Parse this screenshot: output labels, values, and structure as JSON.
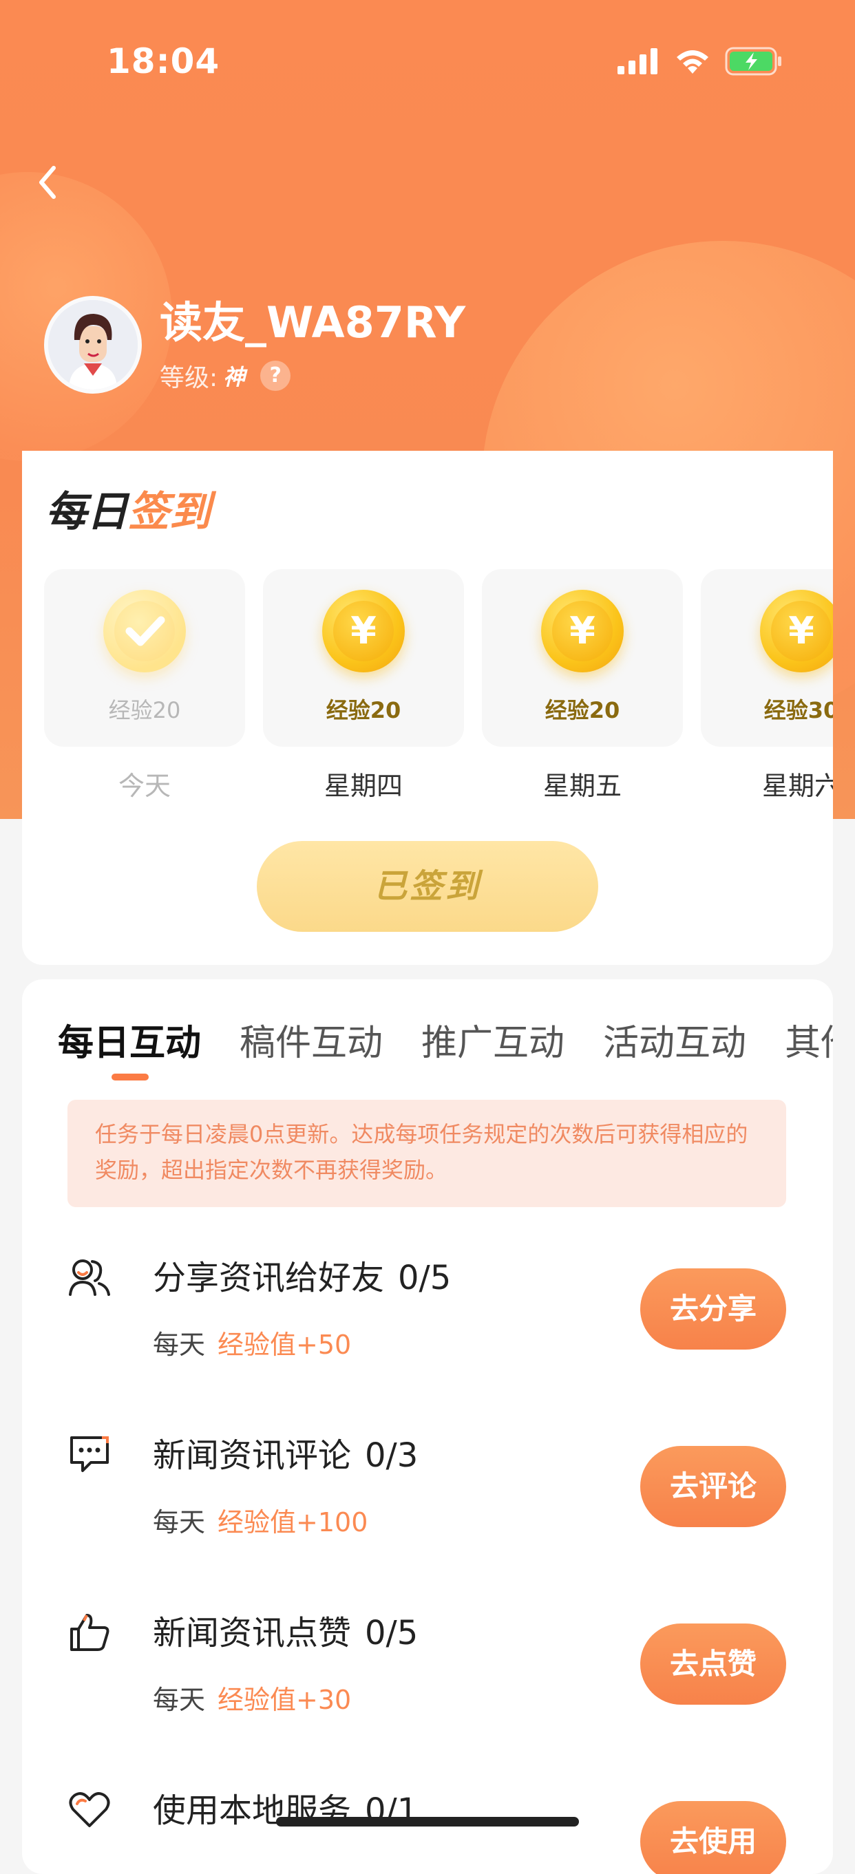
{
  "status_bar": {
    "time": "18:04"
  },
  "profile": {
    "username": "读友_WA87RY",
    "level_label": "等级:",
    "level_value": "神",
    "help": "?"
  },
  "signin": {
    "title_part1": "每日",
    "title_part2": "签到",
    "days": [
      {
        "exp": "经验20",
        "label": "今天",
        "done": true
      },
      {
        "exp": "经验20",
        "label": "星期四",
        "done": false
      },
      {
        "exp": "经验20",
        "label": "星期五",
        "done": false
      },
      {
        "exp": "经验30",
        "label": "星期六",
        "done": false
      }
    ],
    "button": "已签到"
  },
  "tasks_section": {
    "tabs": [
      "每日互动",
      "稿件互动",
      "推广互动",
      "活动互动",
      "其他"
    ],
    "active_tab": 0,
    "notice": "任务于每日凌晨0点更新。达成每项任务规定的次数后可获得相应的奖励，超出指定次数不再获得奖励。",
    "tasks": [
      {
        "icon": "share-friends-icon",
        "title": "分享资讯给好友",
        "count": "0/5",
        "period": "每天",
        "reward": "经验值+50",
        "button": "去分享"
      },
      {
        "icon": "comment-icon",
        "title": "新闻资讯评论",
        "count": "0/3",
        "period": "每天",
        "reward": "经验值+100",
        "button": "去评论"
      },
      {
        "icon": "thumbs-up-icon",
        "title": "新闻资讯点赞",
        "count": "0/5",
        "period": "每天",
        "reward": "经验值+30",
        "button": "去点赞"
      },
      {
        "icon": "heart-icon",
        "title": "使用本地服务",
        "count": "0/1",
        "period": "每天",
        "reward": "",
        "button": "去使用"
      }
    ]
  },
  "colors": {
    "brand": "#fb8a52",
    "accent": "#fb7b44",
    "coin": "#fbc41a",
    "notice_bg": "#fde9e2"
  }
}
